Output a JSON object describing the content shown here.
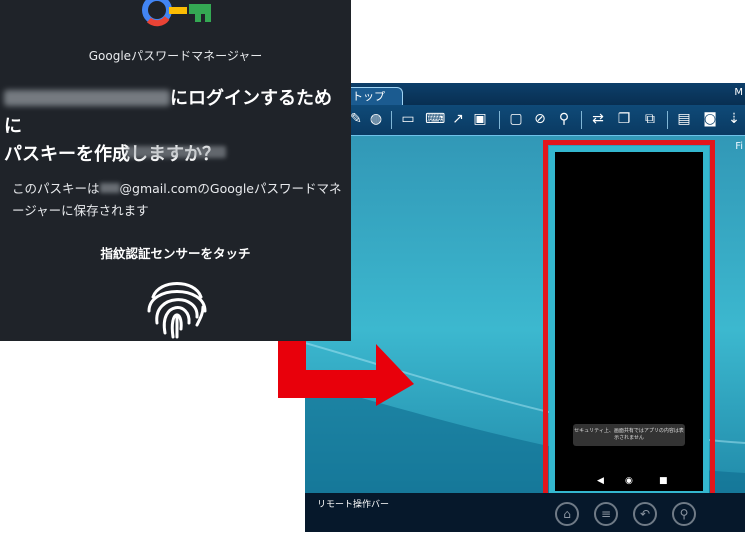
{
  "dialog": {
    "app_name": "Googleパスワードマネージャー",
    "heading_suffix": "にログインするために",
    "heading_line2": "パスキーを作成しますか？",
    "body_prefix": "このパスキーは",
    "body_suffix": "@gmail.comのGoogleパスワードマネージャーに保存されます",
    "touch_label": "指紋認証センサーをタッチ"
  },
  "remote": {
    "tab_label": "トップ",
    "tab_right_label": "M",
    "wifi_label": "Fi",
    "op_bar_label": "リモート操作バー",
    "security_toast": "セキュリティ上、画面共有ではアプリの内容は表示されません",
    "toolbar_icons": [
      "pen-icon",
      "mouse-icon",
      "keyboard-icon",
      "clipboard-icon",
      "share-arrow-icon",
      "display-icon",
      "monitor-icon",
      "block-icon",
      "wand-icon",
      "file-transfer-icon",
      "copy-icon",
      "multi-window-icon",
      "film-icon",
      "camera-icon",
      "download-icon"
    ],
    "op_buttons": [
      "home-icon",
      "menu-icon",
      "back-icon",
      "search-icon"
    ]
  },
  "colors": {
    "dialog_bg": "#1f2329",
    "highlight_red": "#e3161c",
    "arrow_red": "#e8000b",
    "remote_teal": "#3cb8cf"
  }
}
